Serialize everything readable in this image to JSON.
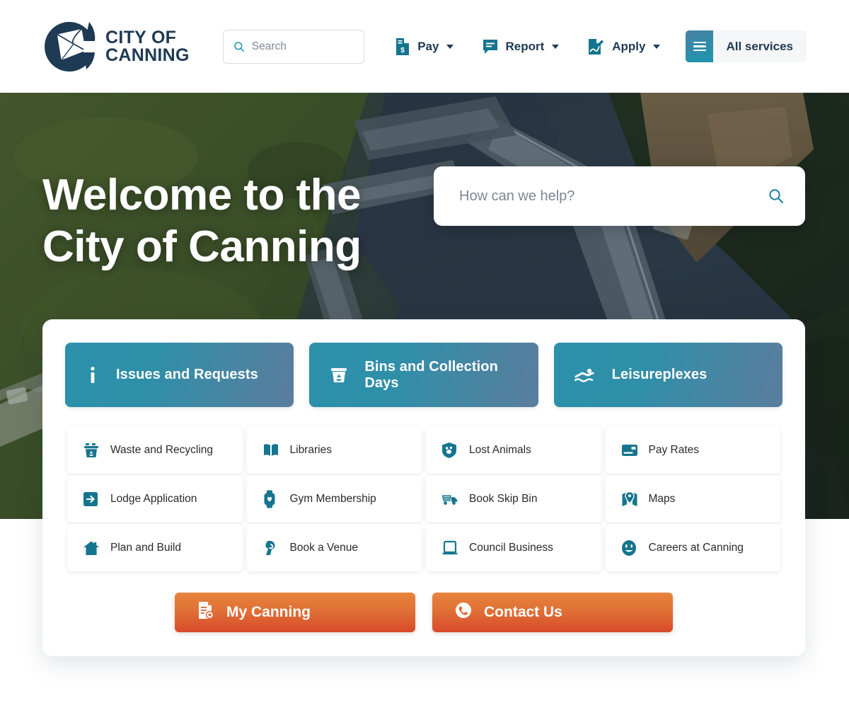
{
  "header": {
    "logo": {
      "icon": "city-of-canning-logo-icon",
      "line1": "CITY OF",
      "line2": "CANNING"
    },
    "search": {
      "icon": "search-icon",
      "placeholder": "Search",
      "value": ""
    },
    "nav": [
      {
        "label": "Pay",
        "icon": "invoice-dollar-icon",
        "has_dropdown": true
      },
      {
        "label": "Report",
        "icon": "speech-bubble-icon",
        "has_dropdown": true
      },
      {
        "label": "Apply",
        "icon": "document-pencil-icon",
        "has_dropdown": true
      }
    ],
    "all_services": {
      "label": "All services",
      "icon": "hamburger-menu-icon"
    }
  },
  "hero": {
    "title_line1": "Welcome to the",
    "title_line2": "City of Canning",
    "search": {
      "placeholder": "How can we help?",
      "value": "",
      "icon": "search-icon"
    },
    "background": "aerial-photo-canning-river-bridge-parkland"
  },
  "panel": {
    "feature_cards": [
      {
        "label": "Issues and Requests",
        "icon": "info-icon"
      },
      {
        "label": "Bins and Collection Days",
        "icon": "recycle-bin-icon"
      },
      {
        "label": "Leisureplexes",
        "icon": "swimmer-icon"
      }
    ],
    "services": [
      {
        "label": "Waste and Recycling",
        "icon": "recycling-bin-icon"
      },
      {
        "label": "Libraries",
        "icon": "open-book-icon"
      },
      {
        "label": "Lost Animals",
        "icon": "pet-shield-icon"
      },
      {
        "label": "Pay Rates",
        "icon": "credit-card-icon"
      },
      {
        "label": "Lodge Application",
        "icon": "arrow-right-box-icon"
      },
      {
        "label": "Gym Membership",
        "icon": "fitness-watch-icon"
      },
      {
        "label": "Book Skip Bin",
        "icon": "skip-bin-truck-icon"
      },
      {
        "label": "Maps",
        "icon": "map-pin-icon"
      },
      {
        "label": "Plan and Build",
        "icon": "house-icon"
      },
      {
        "label": "Book a Venue",
        "icon": "venue-icon"
      },
      {
        "label": "Council Business",
        "icon": "laptop-icon"
      },
      {
        "label": "Careers at Canning",
        "icon": "smiley-face-icon"
      }
    ],
    "cta": [
      {
        "label": "My Canning",
        "icon": "id-card-document-icon"
      },
      {
        "label": "Contact Us",
        "icon": "phone-icon"
      }
    ]
  },
  "colors": {
    "brand_navy": "#1f3a54",
    "brand_teal": "#2590ab",
    "card_gradient_start": "#2c90aa",
    "card_gradient_end": "#5b7d9d",
    "cta_orange_start": "#e8833c",
    "cta_orange_end": "#d8492a",
    "page_background": "#ffffff"
  }
}
